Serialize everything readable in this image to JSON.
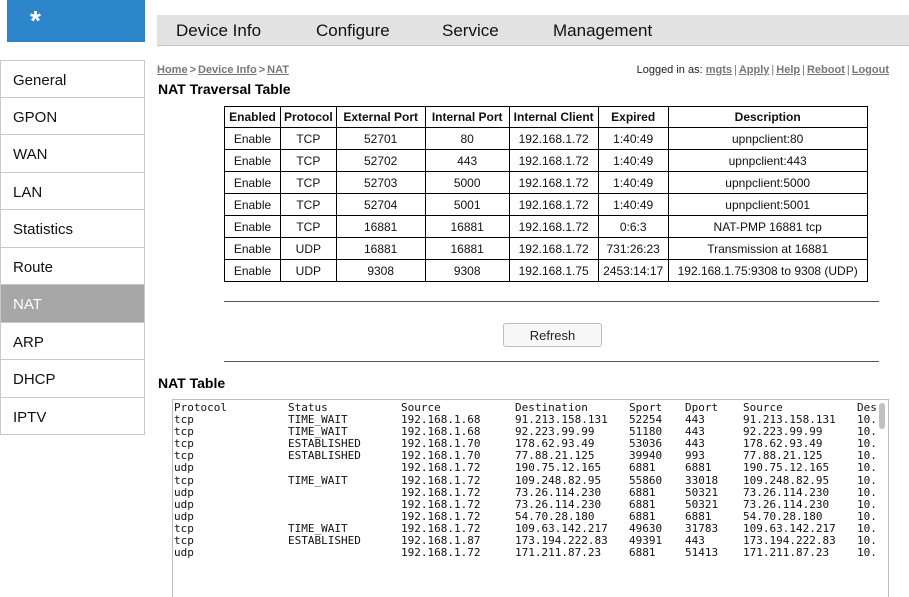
{
  "logo": "*",
  "topnav": [
    "Device Info",
    "Configure",
    "Service",
    "Management"
  ],
  "sidebar": [
    "General",
    "GPON",
    "WAN",
    "LAN",
    "Statistics",
    "Route",
    "NAT",
    "ARP",
    "DHCP",
    "IPTV"
  ],
  "sidebar_active": "NAT",
  "breadcrumb": [
    "Home",
    "Device Info",
    "NAT"
  ],
  "login": {
    "prefix": "Logged in as:",
    "user": "mgts",
    "links": [
      "Apply",
      "Help",
      "Reboot",
      "Logout"
    ]
  },
  "traversal": {
    "title": "NAT Traversal Table",
    "headers": [
      "Enabled",
      "Protocol",
      "External Port",
      "Internal Port",
      "Internal Client",
      "Expired",
      "Description"
    ],
    "rows": [
      [
        "Enable",
        "TCP",
        "52701",
        "80",
        "192.168.1.72",
        "1:40:49",
        "upnpclient:80"
      ],
      [
        "Enable",
        "TCP",
        "52702",
        "443",
        "192.168.1.72",
        "1:40:49",
        "upnpclient:443"
      ],
      [
        "Enable",
        "TCP",
        "52703",
        "5000",
        "192.168.1.72",
        "1:40:49",
        "upnpclient:5000"
      ],
      [
        "Enable",
        "TCP",
        "52704",
        "5001",
        "192.168.1.72",
        "1:40:49",
        "upnpclient:5001"
      ],
      [
        "Enable",
        "TCP",
        "16881",
        "16881",
        "192.168.1.72",
        "0:6:3",
        "NAT-PMP 16881 tcp"
      ],
      [
        "Enable",
        "UDP",
        "16881",
        "16881",
        "192.168.1.72",
        "731:26:23",
        "Transmission at 16881"
      ],
      [
        "Enable",
        "UDP",
        "9308",
        "9308",
        "192.168.1.75",
        "2453:14:17",
        "192.168.1.75:9308 to 9308 (UDP)"
      ]
    ]
  },
  "refresh_label": "Refresh",
  "nat": {
    "title": "NAT Table",
    "headers": [
      "Protocol",
      "Status",
      "Source",
      "Destination",
      "Sport",
      "Dport",
      "Source",
      "Des"
    ],
    "rows": [
      [
        "tcp",
        "TIME_WAIT",
        "192.168.1.68",
        "91.213.158.131",
        "52254",
        "443",
        "91.213.158.131",
        "10."
      ],
      [
        "tcp",
        "TIME_WAIT",
        "192.168.1.68",
        "92.223.99.99",
        "51180",
        "443",
        "92.223.99.99",
        "10."
      ],
      [
        "tcp",
        "ESTABLISHED",
        "192.168.1.70",
        "178.62.93.49",
        "53036",
        "443",
        "178.62.93.49",
        "10."
      ],
      [
        "tcp",
        "ESTABLISHED",
        "192.168.1.70",
        "77.88.21.125",
        "39940",
        "993",
        "77.88.21.125",
        "10."
      ],
      [
        "udp",
        "",
        "192.168.1.72",
        "190.75.12.165",
        "6881",
        "6881",
        "190.75.12.165",
        "10."
      ],
      [
        "tcp",
        "TIME_WAIT",
        "192.168.1.72",
        "109.248.82.95",
        "55860",
        "33018",
        "109.248.82.95",
        "10."
      ],
      [
        "udp",
        "",
        "192.168.1.72",
        "73.26.114.230",
        "6881",
        "50321",
        "73.26.114.230",
        "10."
      ],
      [
        "udp",
        "",
        "192.168.1.72",
        "73.26.114.230",
        "6881",
        "50321",
        "73.26.114.230",
        "10."
      ],
      [
        "udp",
        "",
        "192.168.1.72",
        "54.70.28.180",
        "6881",
        "6881",
        "54.70.28.180",
        "10."
      ],
      [
        "tcp",
        "TIME_WAIT",
        "192.168.1.72",
        "109.63.142.217",
        "49630",
        "31783",
        "109.63.142.217",
        "10."
      ],
      [
        "tcp",
        "ESTABLISHED",
        "192.168.1.87",
        "173.194.222.83",
        "49391",
        "443",
        "173.194.222.83",
        "10."
      ],
      [
        "udp",
        "",
        "192.168.1.72",
        "171.211.87.23",
        "6881",
        "51413",
        "171.211.87.23",
        "10."
      ]
    ]
  }
}
